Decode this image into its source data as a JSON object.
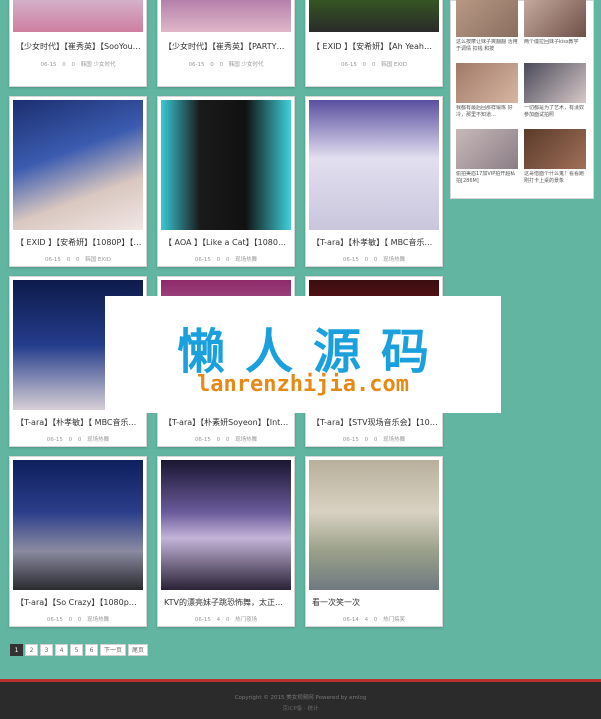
{
  "grid": {
    "cards": [
      {
        "title": "【少女时代】【崔秀英】【SooYoung】",
        "date": "06-15",
        "views": "0",
        "comments": "0",
        "category": "韩国 少女时代"
      },
      {
        "title": "【少女时代】【崔秀英】【PARTY】【...",
        "date": "06-15",
        "views": "0",
        "comments": "0",
        "category": "韩国 少女时代"
      },
      {
        "title": "【 EXID 】【安希妍】【Ah Yeah】【...",
        "date": "06-15",
        "views": "0",
        "comments": "0",
        "category": "韩国 EXID"
      },
      {
        "title": "【 EXID 】【安希妍】【1080P】【1...",
        "date": "06-15",
        "views": "0",
        "comments": "0",
        "category": "韩国 EXID"
      },
      {
        "title": "【 AOA 】【Like a Cat】【1080P】...",
        "date": "06-15",
        "views": "0",
        "comments": "0",
        "category": "现场热舞"
      },
      {
        "title": "【T-ara】【朴孝敏】【 MBC音乐...",
        "date": "06-15",
        "views": "0",
        "comments": "0",
        "category": "现场热舞"
      },
      {
        "title": "【T-ara】【朴孝敏】【 MBC音乐...",
        "date": "06-15",
        "views": "0",
        "comments": "0",
        "category": "现场热舞"
      },
      {
        "title": "【T-ara】【朴素妍Soyeon】【Intro ...",
        "date": "06-15",
        "views": "0",
        "comments": "0",
        "category": "现场热舞"
      },
      {
        "title": "【T-ara】【STV现场音乐会】【1080...",
        "date": "06-15",
        "views": "0",
        "comments": "0",
        "category": "现场热舞"
      },
      {
        "title": "【T-ara】【So Crazy】【1080p】【...",
        "date": "06-15",
        "views": "0",
        "comments": "0",
        "category": "现场热舞"
      },
      {
        "title": "KTV的漂亮妹子跳恐怖舞，太正点了！",
        "date": "06-15",
        "views": "4",
        "comments": "0",
        "category": "热门夜场"
      },
      {
        "title": "看一次笑一次",
        "date": "06-14",
        "views": "4",
        "comments": "0",
        "category": "热门搞笑"
      }
    ]
  },
  "sidebar": {
    "items": [
      {
        "caption": "这么按摩让妹子爽翻翻 活用于调情 扣钱 和按"
      },
      {
        "caption": "两个僵拉回妹子kiss教学"
      },
      {
        "caption": "我都有最后回那样锻炼 好冷，那里不知道..."
      },
      {
        "caption": "一切都是为了艺术，有漢奴参加面试拍照"
      },
      {
        "caption": "偷拍美眉17加VIP拍开超私拍[286M]"
      },
      {
        "caption": "这哥借面个什么鬼！看看跑刚打卡上桌的景象"
      }
    ]
  },
  "pagination": {
    "pages": [
      "1",
      "2",
      "3",
      "4",
      "5",
      "6"
    ],
    "next_label": "下一页",
    "last_label": "尾页"
  },
  "footer": {
    "copyright": "Copyright © 2015 美女视频网 Powered by emlog",
    "sub": "京ICP备 · 统计"
  },
  "watermark": {
    "chinese": "懒人源码",
    "url": "lanrenzhijia.com"
  },
  "colors": {
    "background": "#62b5a1",
    "footer_bar": "#b8302b",
    "watermark_cn": "#1aa1dd",
    "watermark_en": "#e58a17"
  }
}
